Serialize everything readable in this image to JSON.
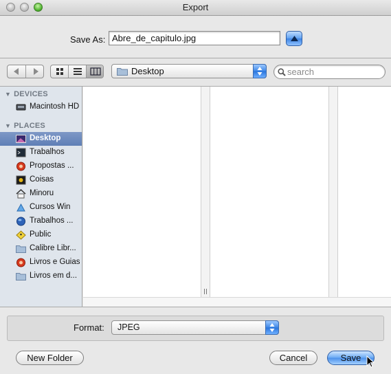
{
  "window": {
    "title": "Export"
  },
  "save_as": {
    "label": "Save As:",
    "filename": "Abre_de_capitulo.jpg"
  },
  "toolbar": {
    "location": "Desktop",
    "search_placeholder": "search"
  },
  "sidebar": {
    "devices_header": "DEVICES",
    "devices": [
      {
        "label": "Macintosh HD",
        "icon": "hard-drive-icon"
      }
    ],
    "places_header": "PLACES",
    "places": [
      {
        "label": "Desktop",
        "icon": "desktop-icon",
        "selected": true
      },
      {
        "label": "Trabalhos",
        "icon": "terminal-icon"
      },
      {
        "label": "Propostas ...",
        "icon": "red-globe-icon"
      },
      {
        "label": "Coisas",
        "icon": "terminal-icon"
      },
      {
        "label": "Minoru",
        "icon": "home-icon"
      },
      {
        "label": "Cursos Win",
        "icon": "app-icon"
      },
      {
        "label": "Trabalhos ...",
        "icon": "blue-globe-icon"
      },
      {
        "label": "Public",
        "icon": "public-icon"
      },
      {
        "label": "Calibre Libr...",
        "icon": "folder-icon"
      },
      {
        "label": "Livros e Guias",
        "icon": "red-globe-icon"
      },
      {
        "label": "Livros em d...",
        "icon": "folder-icon"
      }
    ]
  },
  "format": {
    "label": "Format:",
    "value": "JPEG"
  },
  "buttons": {
    "new_folder": "New Folder",
    "cancel": "Cancel",
    "save": "Save"
  },
  "colors": {
    "accent": "#4b90ea",
    "sidebar_selection": "#6a88bd",
    "sidebar_bg": "#dfe5ec"
  }
}
